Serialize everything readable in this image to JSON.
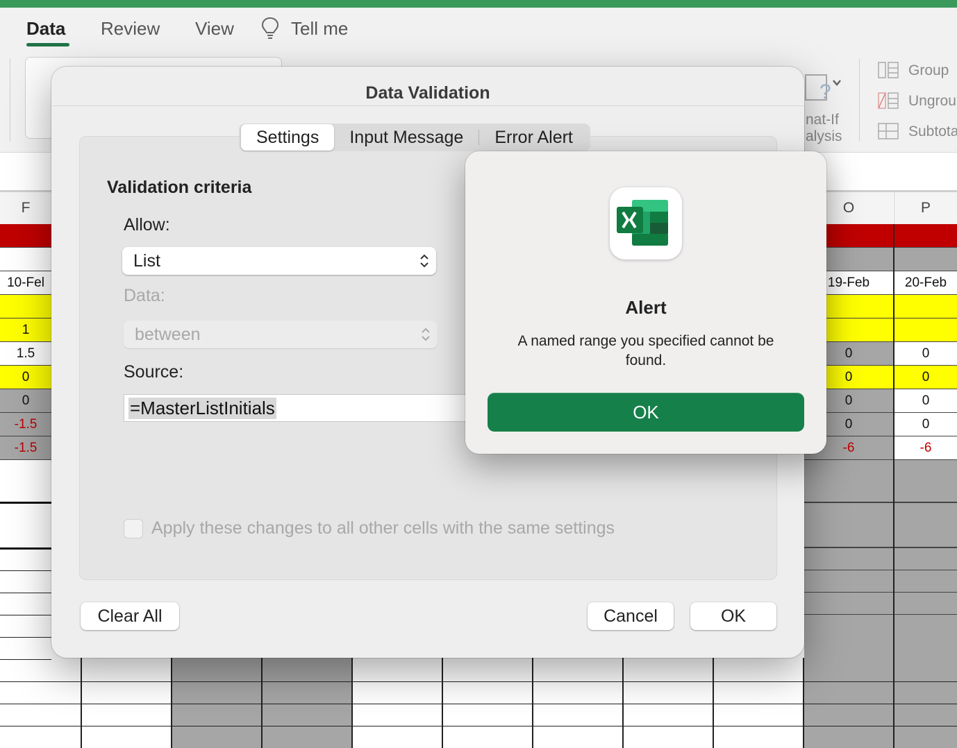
{
  "ribbon": {
    "tabs": [
      {
        "label": "Data",
        "active": true
      },
      {
        "label": "Review",
        "active": false
      },
      {
        "label": "View",
        "active": false
      },
      {
        "label": "Tell me",
        "active": false
      }
    ],
    "group_label": "Group",
    "ungroup_label": "Ungrou",
    "subtotal_label": "Subtota",
    "whatif_line1": "nat-If",
    "whatif_line2": "alysis"
  },
  "sheet": {
    "left_column": {
      "header": "F",
      "cells": [
        "",
        "",
        "10-Fel",
        "",
        "1",
        "1.5",
        "0",
        "0",
        "-1.5",
        "-1.5"
      ]
    },
    "column_o": {
      "header": "O",
      "cells": [
        "",
        "",
        "19-Feb",
        "",
        "",
        "0",
        "0",
        "0",
        "0",
        "-6"
      ]
    },
    "column_p": {
      "header": "P",
      "cells": [
        "",
        "",
        "20-Feb",
        "",
        "",
        "0",
        "0",
        "0",
        "0",
        "-6"
      ]
    }
  },
  "data_validation": {
    "title": "Data Validation",
    "tabs": [
      {
        "label": "Settings",
        "active": true
      },
      {
        "label": "Input Message",
        "active": false
      },
      {
        "label": "Error Alert",
        "active": false
      }
    ],
    "section_title": "Validation criteria",
    "allow_label": "Allow:",
    "allow_value": "List",
    "data_label": "Data:",
    "data_value": "between",
    "source_label": "Source:",
    "source_value": "=MasterListInitials",
    "apply_all_label": "Apply these changes to all other cells with the same settings",
    "clear_all_label": "Clear All",
    "cancel_label": "Cancel",
    "ok_label": "OK"
  },
  "alert": {
    "title": "Alert",
    "message": "A named range you specified cannot be found.",
    "ok_label": "OK",
    "app_icon": "excel-icon"
  },
  "colors": {
    "excel_green": "#217346",
    "ok_green": "#16804a",
    "header_red": "#c00000",
    "highlight_yellow": "#ffff00",
    "cell_gray": "#a6a6a6"
  }
}
